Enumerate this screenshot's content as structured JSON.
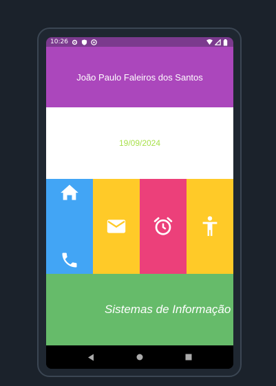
{
  "status_bar": {
    "time": "10:26"
  },
  "header": {
    "name": "João Paulo Faleiros dos Santos"
  },
  "date_area": {
    "date": "19/09/2024"
  },
  "icons": [
    "home-icon",
    "phone-icon",
    "mail-icon",
    "alarm-icon",
    "accessibility-icon"
  ],
  "footer": {
    "text": "Sistemas de Informação"
  },
  "colors": {
    "header": "#ab47bc",
    "status": "#7b3a8e",
    "date_text": "#a8e04b",
    "blue": "#42a5f5",
    "amber": "#ffca28",
    "pink": "#ec407a",
    "green": "#66bb6a"
  }
}
